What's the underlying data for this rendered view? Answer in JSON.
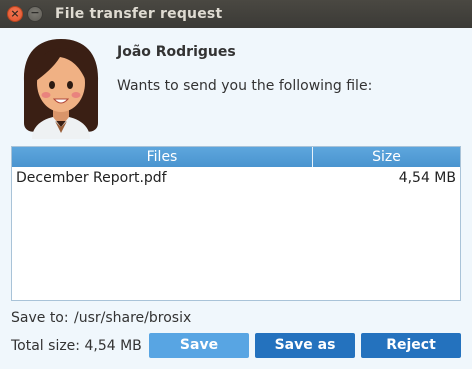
{
  "window": {
    "title": "File transfer request",
    "close_glyph": "×",
    "minimize_glyph": "−"
  },
  "request": {
    "sender_name": "João Rodrigues",
    "message": "Wants to send you the following file:",
    "avatar_icon": "woman-avatar-icon"
  },
  "file_table": {
    "columns": [
      "Files",
      "Size"
    ],
    "rows": [
      {
        "name": "December Report.pdf",
        "size": "4,54 MB"
      }
    ]
  },
  "footer": {
    "save_to_label": "Save to:",
    "save_to_path": "/usr/share/brosix",
    "total_size_text": "Total size: 4,54 MB"
  },
  "buttons": {
    "save": "Save",
    "save_as": "Save as",
    "reject": "Reject"
  },
  "colors": {
    "titlebar": "#3b3a36",
    "header_blue": "#4a94cf",
    "button_primary": "#2472be",
    "button_light": "#58a5e3",
    "close_orange": "#e0512b"
  }
}
